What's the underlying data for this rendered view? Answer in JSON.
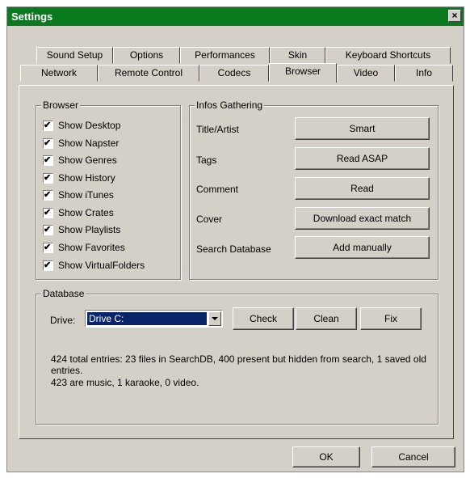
{
  "window": {
    "title": "Settings",
    "close_glyph": "×"
  },
  "tabs_row1": [
    "Sound Setup",
    "Options",
    "Performances",
    "Skin",
    "Keyboard Shortcuts"
  ],
  "tabs_row2": [
    "Network",
    "Remote Control",
    "Codecs",
    "Browser",
    "Video",
    "Info"
  ],
  "active_tab": "Browser",
  "browser_group": {
    "legend": "Browser",
    "items": [
      {
        "label": "Show Desktop",
        "checked": true
      },
      {
        "label": "Show Napster",
        "checked": true
      },
      {
        "label": "Show Genres",
        "checked": true
      },
      {
        "label": "Show History",
        "checked": true
      },
      {
        "label": "Show iTunes",
        "checked": true
      },
      {
        "label": "Show Crates",
        "checked": true
      },
      {
        "label": "Show Playlists",
        "checked": true
      },
      {
        "label": "Show Favorites",
        "checked": true
      },
      {
        "label": "Show VirtualFolders",
        "checked": true
      }
    ]
  },
  "infos_group": {
    "legend": "Infos Gathering",
    "rows": [
      {
        "label": "Title/Artist",
        "button": "Smart"
      },
      {
        "label": "Tags",
        "button": "Read ASAP"
      },
      {
        "label": "Comment",
        "button": "Read"
      },
      {
        "label": "Cover",
        "button": "Download exact match"
      },
      {
        "label": "Search Database",
        "button": "Add manually"
      }
    ]
  },
  "database_group": {
    "legend": "Database",
    "drive_label": "Drive:",
    "drive_value": "Drive C:",
    "check": "Check",
    "clean": "Clean",
    "fix": "Fix",
    "info_line1": "424 total entries: 23 files in SearchDB, 400 present but hidden from search, 1 saved old entries.",
    "info_line2": "423 are music, 1 karaoke, 0 video."
  },
  "footer": {
    "ok": "OK",
    "cancel": "Cancel"
  }
}
